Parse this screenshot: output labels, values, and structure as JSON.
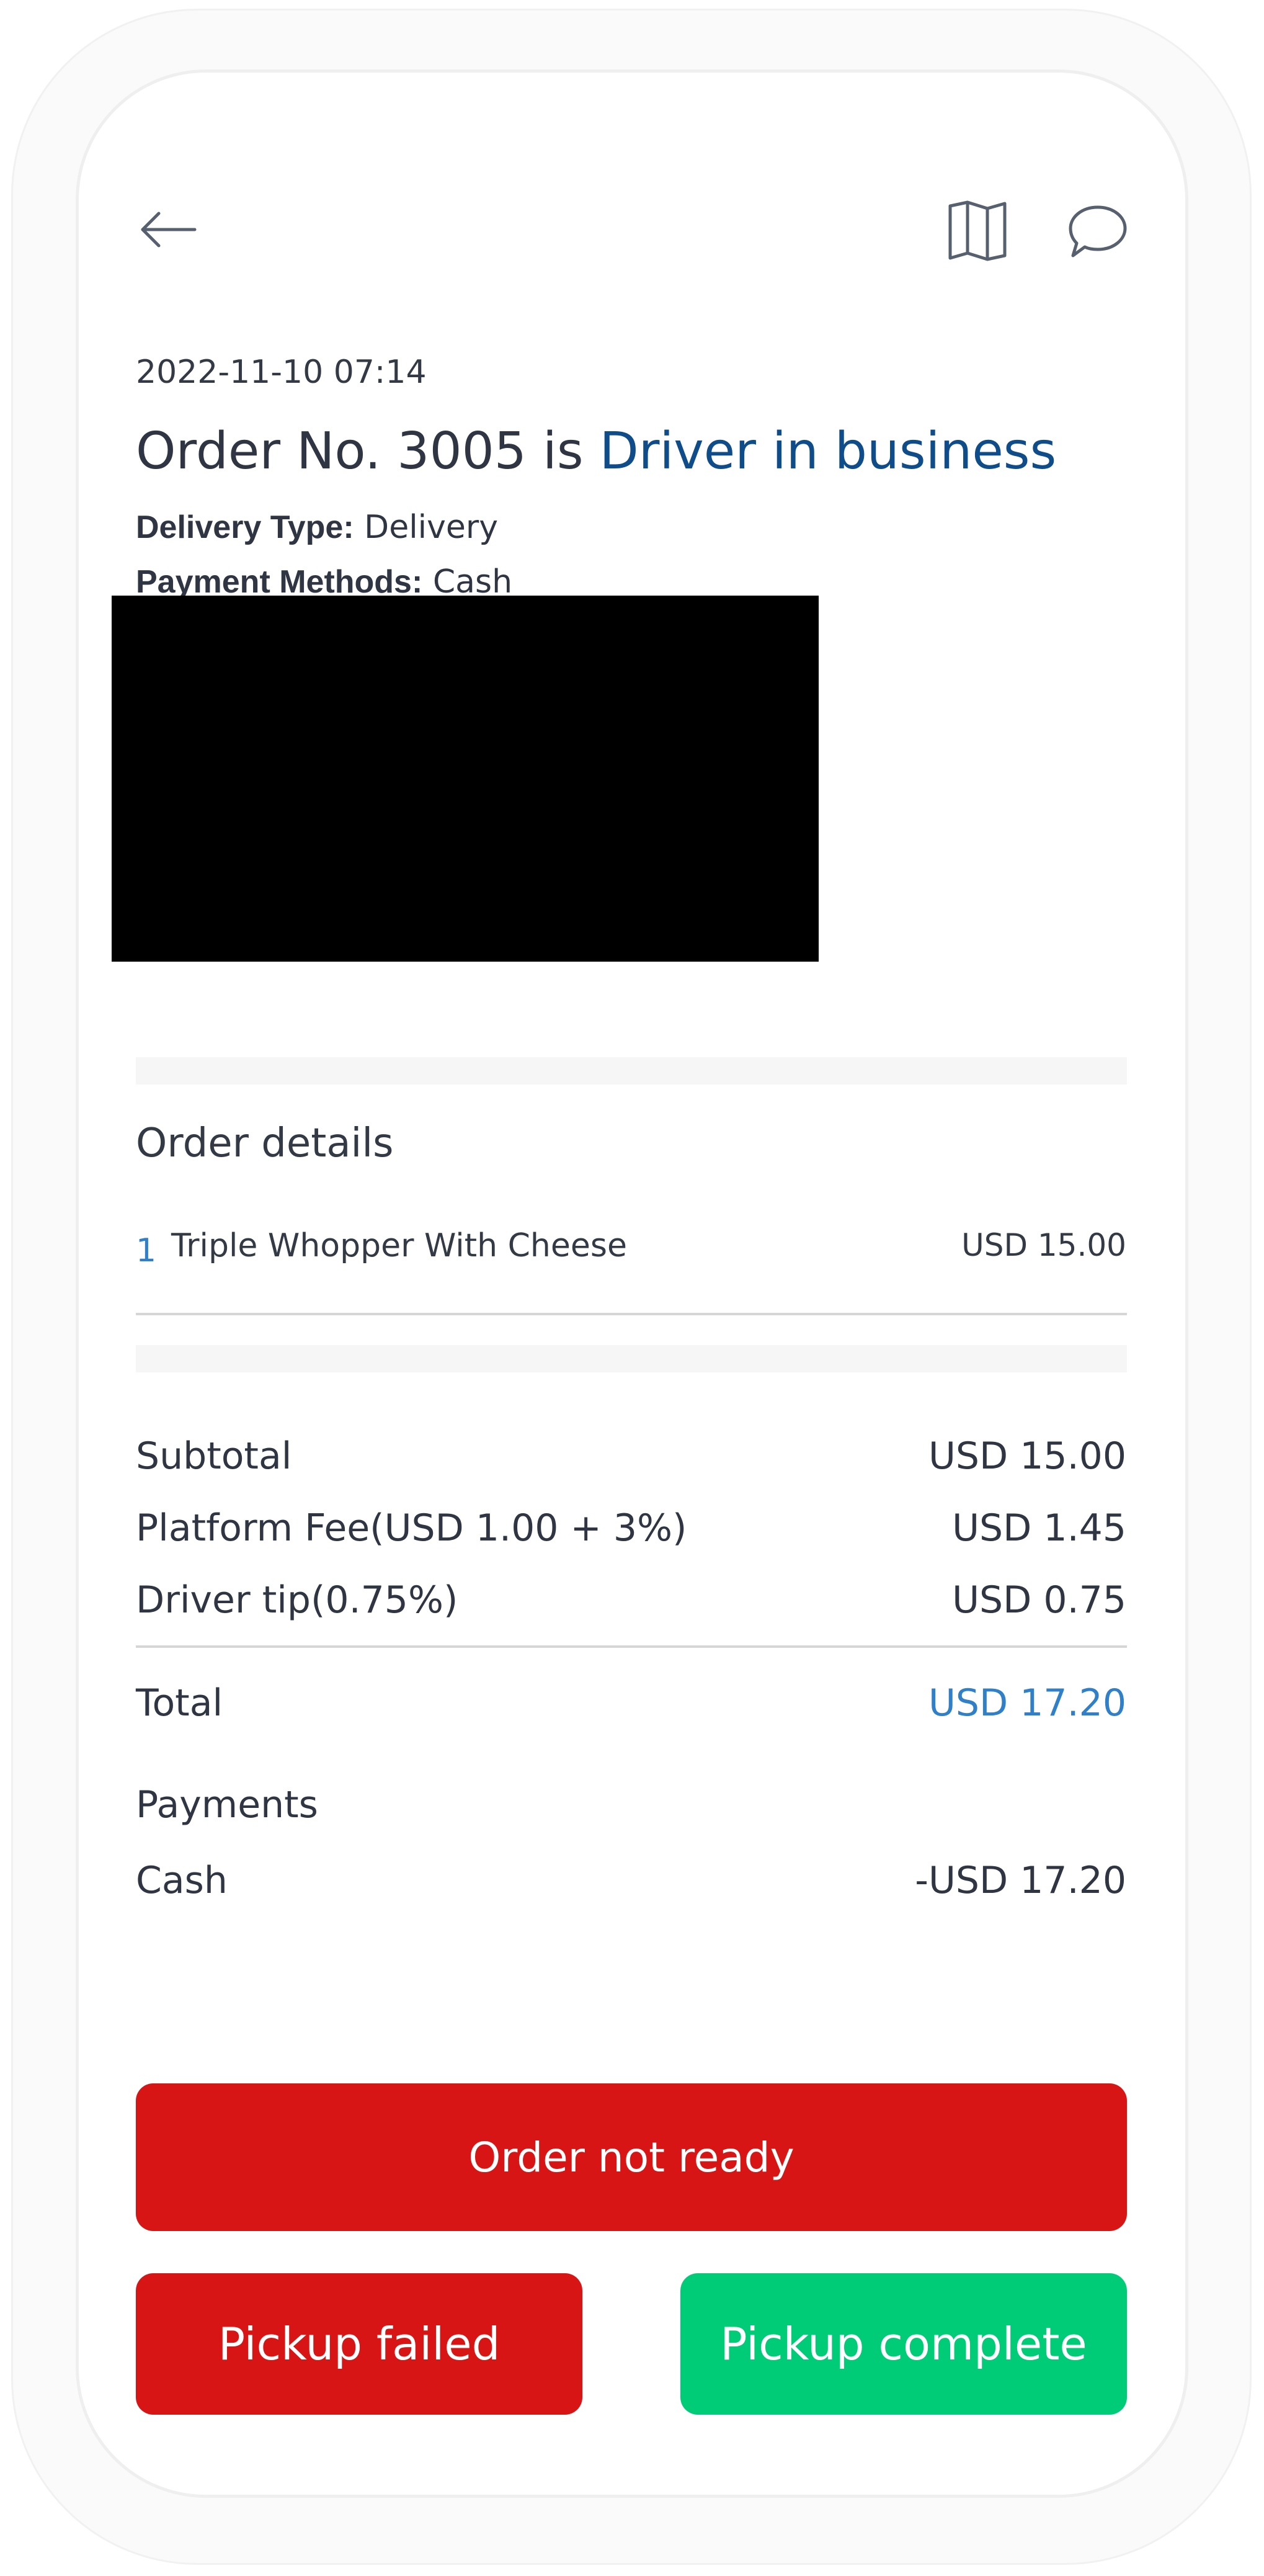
{
  "header": {
    "back_icon": "arrow-left-icon",
    "map_icon": "map-icon",
    "chat_icon": "chat-bubble-icon"
  },
  "order": {
    "datetime": "2022-11-10 07:14",
    "title_prefix": "Order No. 3005 is",
    "status": "Driver in business",
    "delivery_type_label": "Delivery Type:",
    "delivery_type_value": "Delivery",
    "payment_methods_label": "Payment Methods:",
    "payment_methods_value": "Cash"
  },
  "details": {
    "heading": "Order details",
    "items": [
      {
        "qty": "1",
        "name": "Triple Whopper With Cheese",
        "price": "USD 15.00"
      }
    ]
  },
  "summary": {
    "subtotal_label": "Subtotal",
    "subtotal_value": "USD 15.00",
    "platform_fee_label": "Platform Fee(USD 1.00 + 3%)",
    "platform_fee_value": "USD 1.45",
    "driver_tip_label": "Driver tip(0.75%)",
    "driver_tip_value": "USD 0.75",
    "total_label": "Total",
    "total_value": "USD 17.20"
  },
  "payments": {
    "heading": "Payments",
    "method_label": "Cash",
    "method_value": "-USD 17.20"
  },
  "actions": {
    "not_ready": "Order not ready",
    "pickup_failed": "Pickup failed",
    "pickup_complete": "Pickup complete"
  },
  "colors": {
    "status_blue": "#0f4c8a",
    "total_blue": "#2f80c8",
    "danger_red": "#d71515",
    "success_green": "#00cc78"
  }
}
